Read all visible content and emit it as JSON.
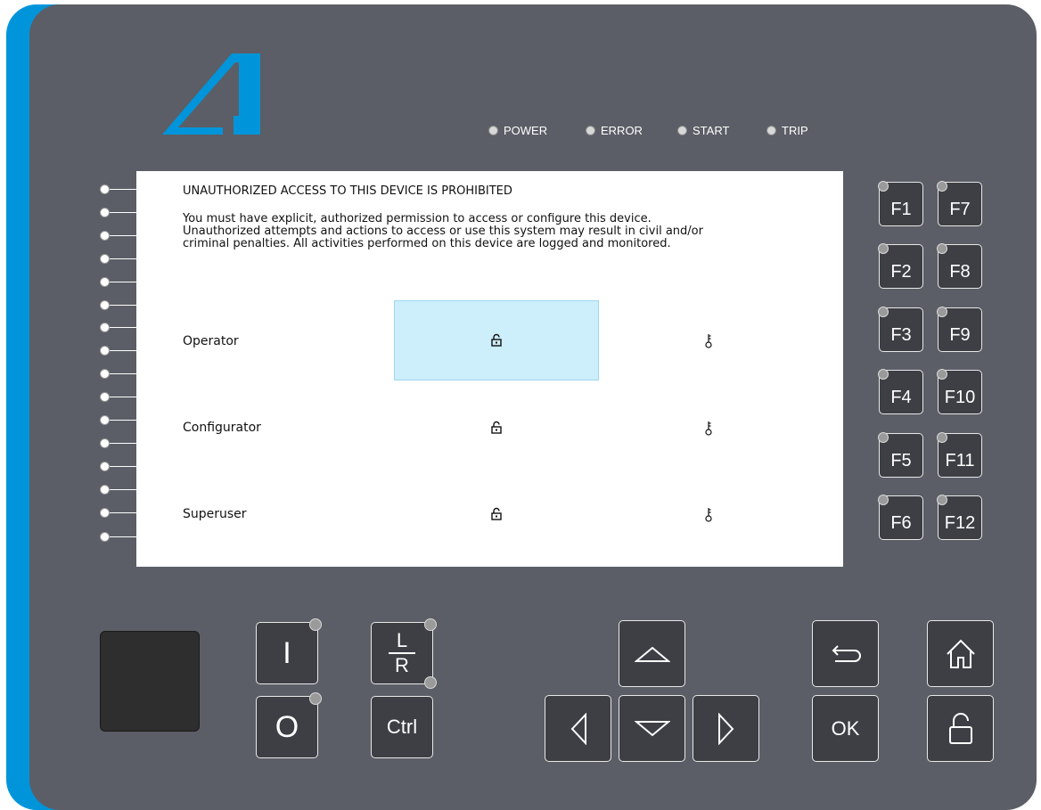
{
  "leds": [
    "POWER",
    "ERROR",
    "START",
    "TRIP"
  ],
  "screen": {
    "title": "UNAUTHORIZED ACCESS TO THIS DEVICE IS PROHIBITED",
    "message": "You must have explicit, authorized permission to access or configure this device.\nUnauthorized attempts and actions to access or use this system may result in civil and/or\ncriminal penalties. All activities performed on this device are logged and monitored.",
    "users": [
      "Operator",
      "Configurator",
      "Superuser"
    ],
    "selected_user": "Operator"
  },
  "function_keys": [
    "F1",
    "F2",
    "F3",
    "F4",
    "F5",
    "F6",
    "F7",
    "F8",
    "F9",
    "F10",
    "F11",
    "F12"
  ],
  "keys": {
    "on": "I",
    "off": "O",
    "local_remote_top": "L",
    "local_remote_bottom": "R",
    "ctrl": "Ctrl",
    "ok": "OK"
  },
  "icons": {
    "lock": "lock-icon",
    "key": "key-icon",
    "home": "home-icon",
    "back": "back-arrow-icon",
    "up": "up-arrow-icon",
    "down": "down-arrow-icon",
    "left": "left-arrow-icon",
    "right": "right-arrow-icon"
  },
  "colors": {
    "panel": "#5b5e66",
    "accent": "#0095da",
    "selection": "#cdeefb"
  }
}
